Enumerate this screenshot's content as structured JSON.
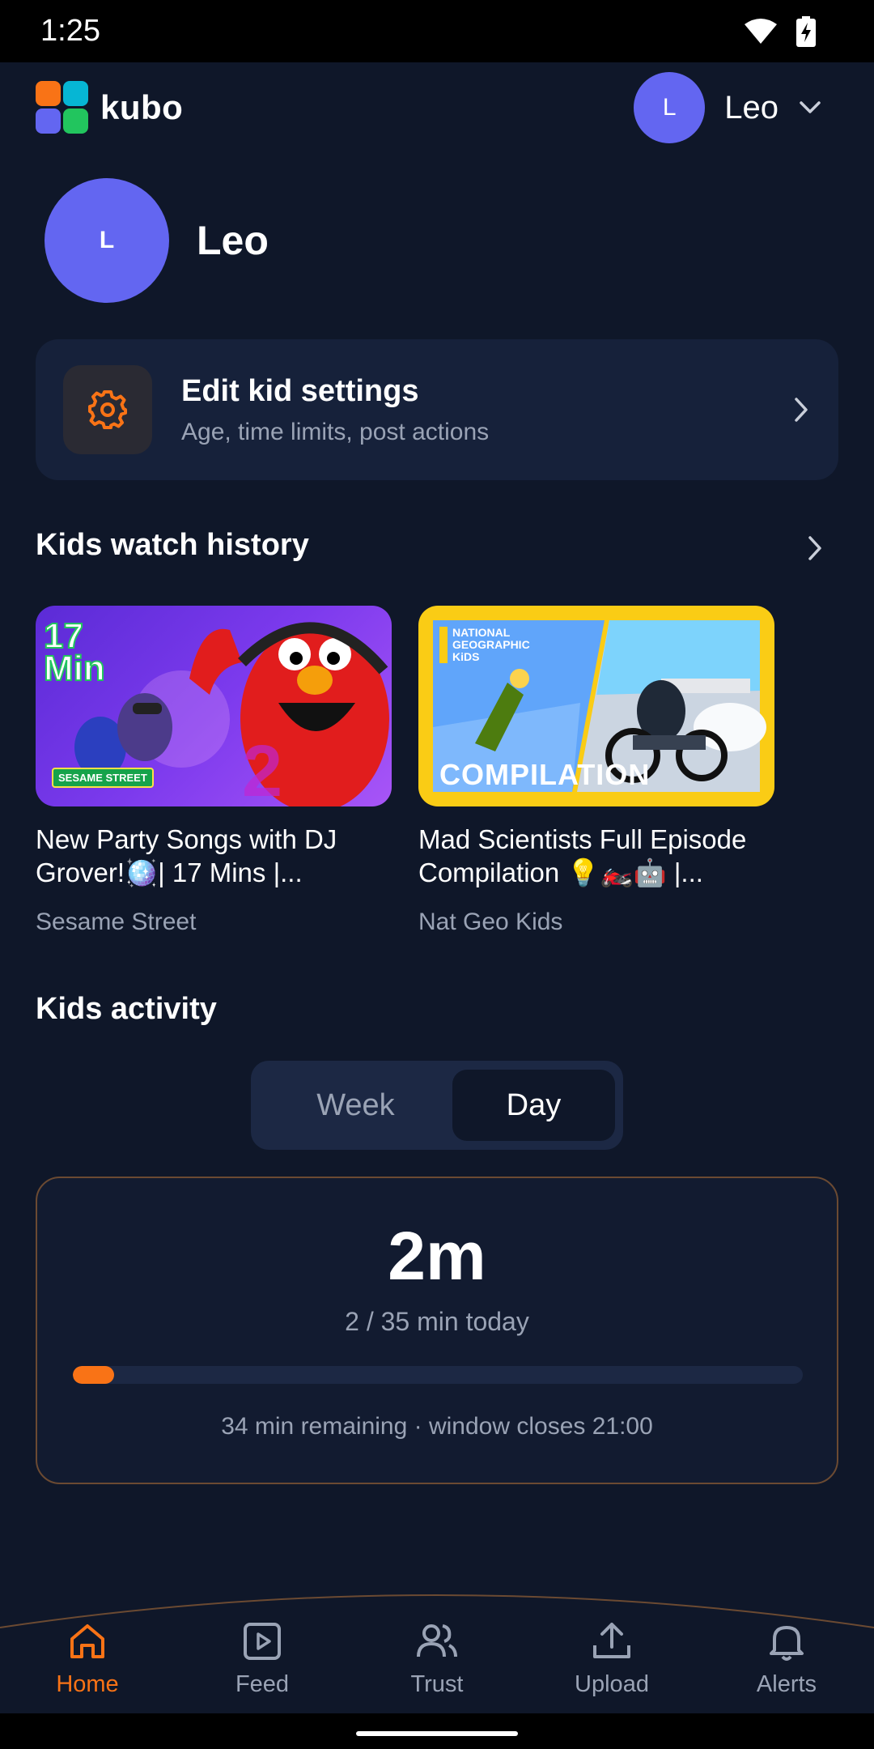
{
  "status_bar": {
    "time": "1:25",
    "wifi_icon": "wifi-icon",
    "battery_icon": "battery-charging-icon"
  },
  "header": {
    "app_name": "kubo",
    "logo_colors": [
      "#f97316",
      "#06b6d4",
      "#6366f1",
      "#22c55e"
    ],
    "profile_initial": "L",
    "profile_name": "Leo",
    "dropdown_icon": "chevron-down-icon"
  },
  "kid": {
    "initial": "L",
    "name": "Leo"
  },
  "settings_card": {
    "title": "Edit kid settings",
    "subtitle": "Age, time limits, post actions",
    "icon": "gear-icon"
  },
  "watch_history": {
    "title": "Kids watch history",
    "videos": [
      {
        "title": "New Party Songs with DJ Grover!🪩| 17 Mins |...",
        "channel": "Sesame Street",
        "thumb_badge": "17 Min",
        "thumb_label": "SESAME STREET"
      },
      {
        "title": "Mad Scientists Full Episode Compilation 💡🏍️🤖 |...",
        "channel": "Nat Geo Kids",
        "thumb_badge": "NATIONAL GEOGRAPHIC KiDS",
        "thumb_label": "COMPILATION"
      }
    ]
  },
  "activity": {
    "title": "Kids activity",
    "tabs": [
      "Week",
      "Day"
    ],
    "selected_tab": "Day",
    "big_value": "2m",
    "summary": "2 / 35 min today",
    "progress_fraction": 0.057,
    "footnote": "34 min remaining · window closes 21:00",
    "accent": "#f97316"
  },
  "nav": {
    "items": [
      {
        "label": "Home",
        "icon": "home-icon",
        "active": true
      },
      {
        "label": "Feed",
        "icon": "play-icon",
        "active": false
      },
      {
        "label": "Trust",
        "icon": "users-icon",
        "active": false
      },
      {
        "label": "Upload",
        "icon": "upload-icon",
        "active": false
      },
      {
        "label": "Alerts",
        "icon": "bell-icon",
        "active": false
      }
    ]
  }
}
